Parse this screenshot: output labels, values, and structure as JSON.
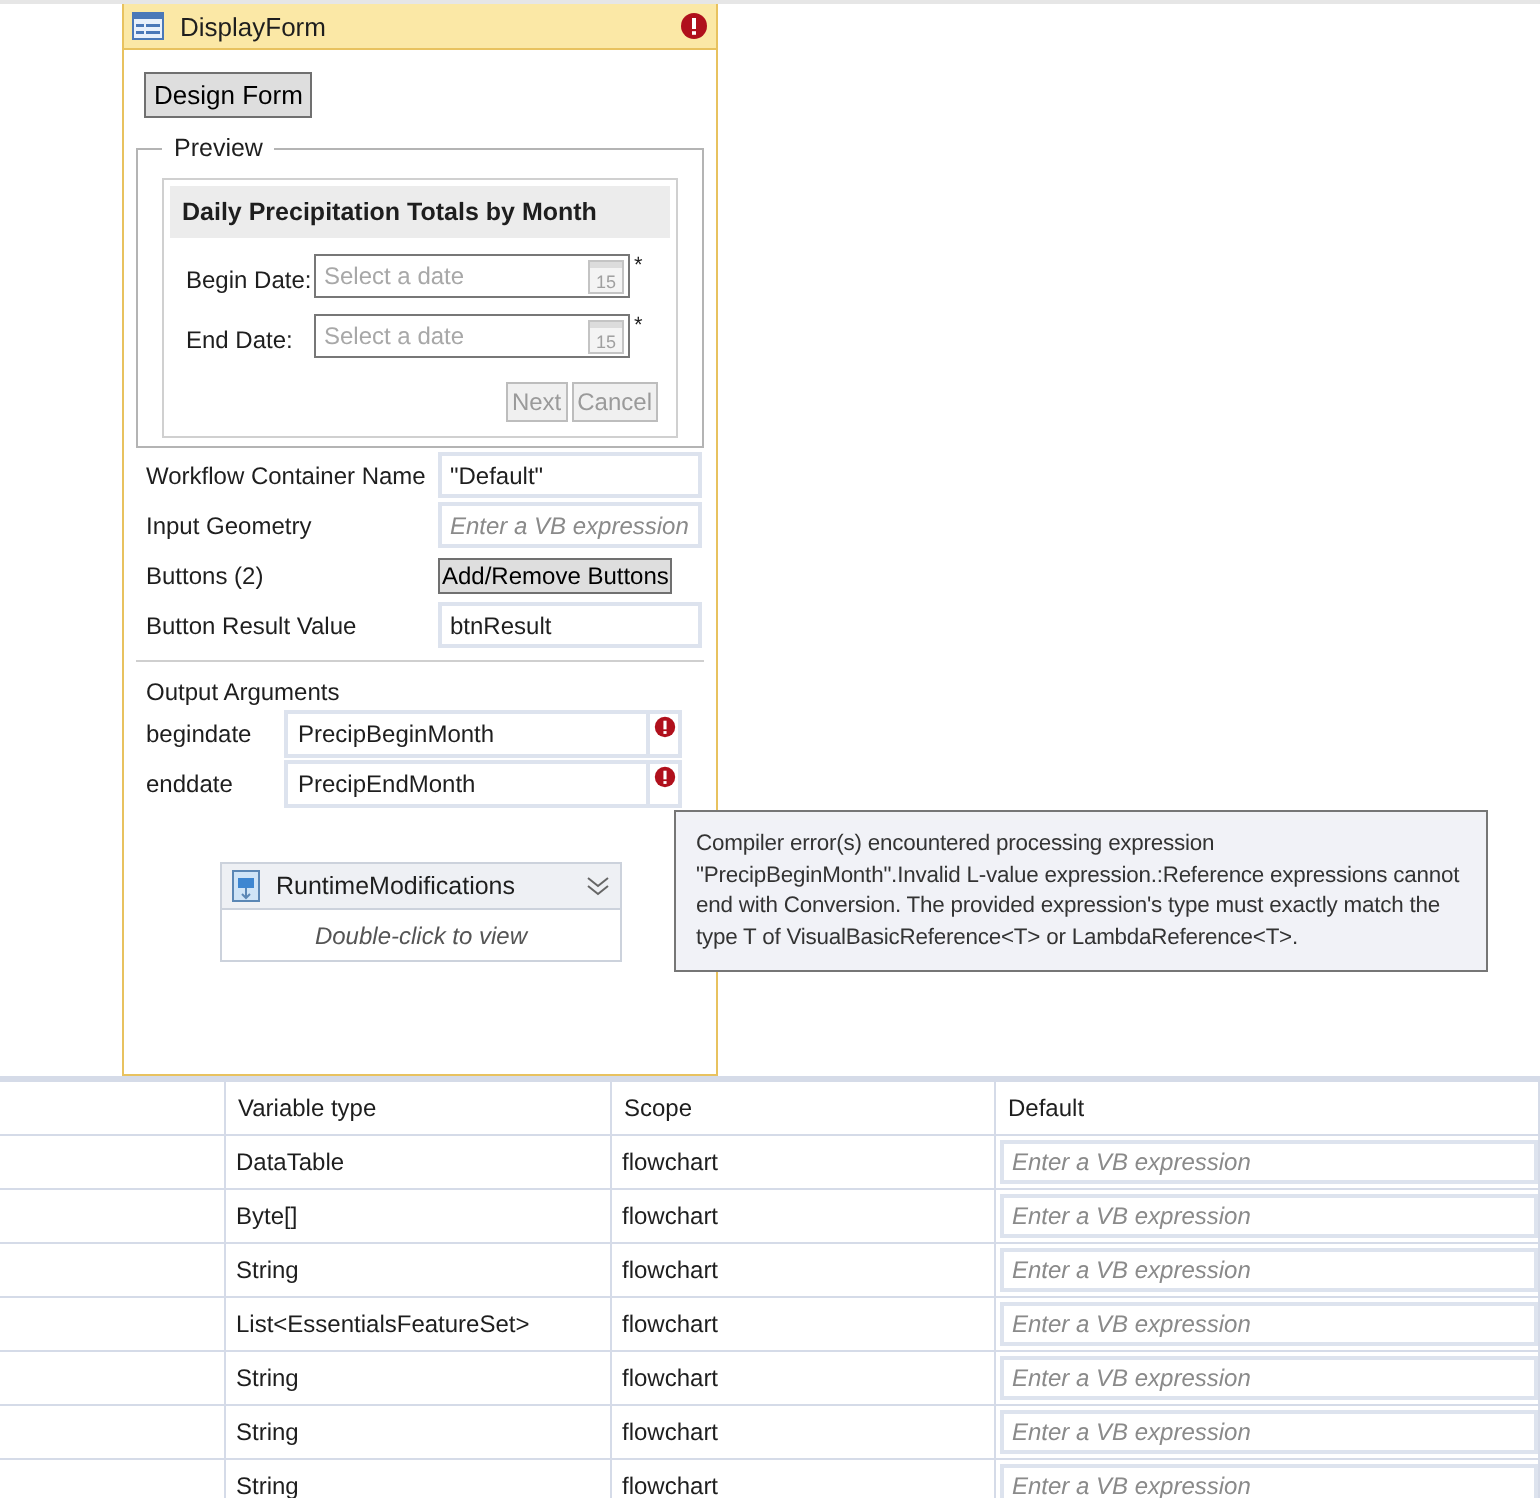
{
  "activity": {
    "title": "DisplayForm",
    "has_error": true,
    "design_button": "Design Form",
    "preview": {
      "legend": "Preview",
      "form_title": "Daily Precipitation Totals by Month",
      "fields": [
        {
          "label": "Begin Date:",
          "placeholder": "Select a date",
          "calendar_day": "15",
          "required_mark": "*"
        },
        {
          "label": "End Date:",
          "placeholder": "Select a date",
          "calendar_day": "15",
          "required_mark": "*"
        }
      ],
      "buttons": [
        {
          "label": "Next",
          "disabled": true
        },
        {
          "label": "Cancel",
          "disabled": true
        }
      ]
    },
    "properties": [
      {
        "kind": "field",
        "label": "Workflow Container Name",
        "value": "\"Default\""
      },
      {
        "kind": "field",
        "label": "Input Geometry",
        "placeholder": "Enter a VB expression"
      },
      {
        "kind": "button",
        "label": "Buttons (2)",
        "button": "Add/Remove Buttons"
      },
      {
        "kind": "field",
        "label": "Button Result Value",
        "value": "btnResult"
      }
    ],
    "output_arguments": {
      "heading": "Output Arguments",
      "items": [
        {
          "name": "begindate",
          "value": "PrecipBeginMonth",
          "error": true
        },
        {
          "name": "enddate",
          "value": "PrecipEndMonth",
          "error": true
        }
      ]
    },
    "child_activity": {
      "title": "RuntimeModifications",
      "hint": "Double-click to view"
    }
  },
  "tooltip": {
    "text": "Compiler error(s) encountered processing expression \"PrecipBeginMonth\".Invalid L-value expression.:Reference expressions cannot end with Conversion. The provided expression's type must exactly match the type T of VisualBasicReference<T> or LambdaReference<T>."
  },
  "variables": {
    "columns": [
      "Variable type",
      "Scope",
      "Default"
    ],
    "rows": [
      {
        "type": "DataTable",
        "scope": "flowchart",
        "default_placeholder": "Enter a VB expression"
      },
      {
        "type": "Byte[]",
        "scope": "flowchart",
        "default_placeholder": "Enter a VB expression"
      },
      {
        "type": "String",
        "scope": "flowchart",
        "default_placeholder": "Enter a VB expression"
      },
      {
        "type": "List<EssentialsFeatureSet>",
        "scope": "flowchart",
        "default_placeholder": "Enter a VB expression"
      },
      {
        "type": "String",
        "scope": "flowchart",
        "default_placeholder": "Enter a VB expression"
      },
      {
        "type": "String",
        "scope": "flowchart",
        "default_placeholder": "Enter a VB expression"
      },
      {
        "type": "String",
        "scope": "flowchart",
        "default_placeholder": "Enter a VB expression"
      }
    ]
  }
}
